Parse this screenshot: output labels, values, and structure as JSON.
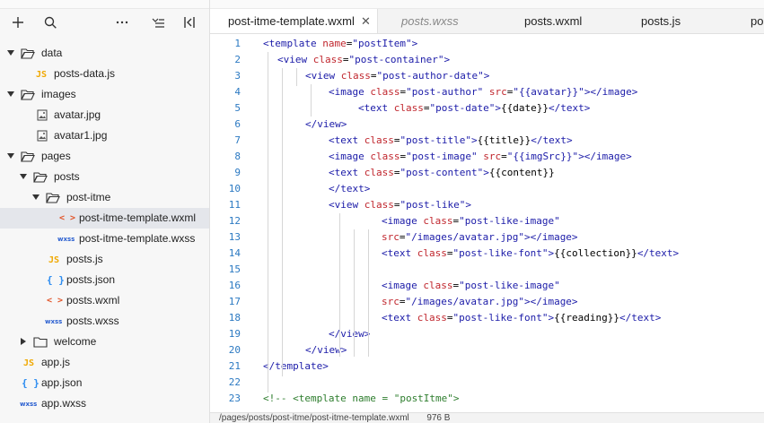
{
  "toolbar": {
    "add": "+",
    "more": "···"
  },
  "tree": [
    {
      "label": "data",
      "type": "folder",
      "depth": 0,
      "expanded": true
    },
    {
      "label": "posts-data.js",
      "type": "js",
      "depth": 1
    },
    {
      "label": "images",
      "type": "folder",
      "depth": 0,
      "expanded": true
    },
    {
      "label": "avatar.jpg",
      "type": "image",
      "depth": 1
    },
    {
      "label": "avatar1.jpg",
      "type": "image",
      "depth": 1
    },
    {
      "label": "pages",
      "type": "folder",
      "depth": 0,
      "expanded": true
    },
    {
      "label": "posts",
      "type": "folder",
      "depth": 1,
      "expanded": true
    },
    {
      "label": "post-itme",
      "type": "folder",
      "depth": 2,
      "expanded": true
    },
    {
      "label": "post-itme-template.wxml",
      "type": "wxml",
      "depth": 3,
      "selected": true
    },
    {
      "label": "post-itme-template.wxss",
      "type": "wxss",
      "depth": 3
    },
    {
      "label": "posts.js",
      "type": "js",
      "depth": 2
    },
    {
      "label": "posts.json",
      "type": "json",
      "depth": 2
    },
    {
      "label": "posts.wxml",
      "type": "wxml",
      "depth": 2
    },
    {
      "label": "posts.wxss",
      "type": "wxss",
      "depth": 2
    },
    {
      "label": "welcome",
      "type": "folder",
      "depth": 1,
      "expanded": false
    },
    {
      "label": "app.js",
      "type": "js",
      "depth": 0
    },
    {
      "label": "app.json",
      "type": "json",
      "depth": 0
    },
    {
      "label": "app.wxss",
      "type": "wxss",
      "depth": 0
    }
  ],
  "icons": {
    "js": "JS",
    "json": "{ }",
    "wxml": "< >",
    "wxss": "wxss"
  },
  "tabs": [
    {
      "label": "post-itme-template.wxml",
      "active": true,
      "closable": true
    },
    {
      "label": "posts.wxss",
      "italic": true
    },
    {
      "label": "posts.wxml"
    },
    {
      "label": "posts.js"
    },
    {
      "label": "po"
    }
  ],
  "close_glyph": "✕",
  "code_lines": [
    {
      "n": "1",
      "indent": 0,
      "tokens": [
        [
          "tag",
          "<template "
        ],
        [
          "attr",
          "name"
        ],
        [
          "plain",
          "="
        ],
        [
          "str",
          "\"postItem\""
        ],
        [
          "tag",
          ">"
        ]
      ]
    },
    {
      "n": "2",
      "indent": 1,
      "tokens": [
        [
          "tag",
          "<view "
        ],
        [
          "attr",
          "class"
        ],
        [
          "plain",
          "="
        ],
        [
          "str",
          "\"post-container\""
        ],
        [
          "tag",
          ">"
        ]
      ]
    },
    {
      "n": "3",
      "indent": 2,
      "tokens": [
        [
          "tag",
          "<view "
        ],
        [
          "attr",
          "class"
        ],
        [
          "plain",
          "="
        ],
        [
          "str",
          "\"post-author-date\""
        ],
        [
          "tag",
          ">"
        ]
      ]
    },
    {
      "n": "4",
      "indent": 3,
      "tokens": [
        [
          "tag",
          "<image "
        ],
        [
          "attr",
          "class"
        ],
        [
          "plain",
          "="
        ],
        [
          "str",
          "\"post-author\" "
        ],
        [
          "attr",
          "src"
        ],
        [
          "plain",
          "="
        ],
        [
          "str",
          "\"{{avatar}}\""
        ],
        [
          "tag",
          "></image>"
        ]
      ]
    },
    {
      "n": "5",
      "indent": 4,
      "tokens": [
        [
          "tag",
          "<text "
        ],
        [
          "attr",
          "class"
        ],
        [
          "plain",
          "="
        ],
        [
          "str",
          "\"post-date\""
        ],
        [
          "tag",
          ">"
        ],
        [
          "plain",
          "{{date}}"
        ],
        [
          "tag",
          "</text>"
        ]
      ]
    },
    {
      "n": "6",
      "indent": 2,
      "tokens": [
        [
          "tag",
          "</view>"
        ]
      ]
    },
    {
      "n": "7",
      "indent": 3,
      "tokens": [
        [
          "tag",
          "<text "
        ],
        [
          "attr",
          "class"
        ],
        [
          "plain",
          "="
        ],
        [
          "str",
          "\"post-title\""
        ],
        [
          "tag",
          ">"
        ],
        [
          "plain",
          "{{title}}"
        ],
        [
          "tag",
          "</text>"
        ]
      ]
    },
    {
      "n": "8",
      "indent": 3,
      "tokens": [
        [
          "tag",
          "<image "
        ],
        [
          "attr",
          "class"
        ],
        [
          "plain",
          "="
        ],
        [
          "str",
          "\"post-image\" "
        ],
        [
          "attr",
          "src"
        ],
        [
          "plain",
          "="
        ],
        [
          "str",
          "\"{{imgSrc}}\""
        ],
        [
          "tag",
          "></image>"
        ]
      ]
    },
    {
      "n": "9",
      "indent": 3,
      "tokens": [
        [
          "tag",
          "<text "
        ],
        [
          "attr",
          "class"
        ],
        [
          "plain",
          "="
        ],
        [
          "str",
          "\"post-content\""
        ],
        [
          "tag",
          ">"
        ],
        [
          "plain",
          "{{content}}"
        ]
      ]
    },
    {
      "n": "10",
      "indent": 3,
      "tokens": [
        [
          "tag",
          "</text>"
        ]
      ]
    },
    {
      "n": "11",
      "indent": 3,
      "tokens": [
        [
          "tag",
          "<view "
        ],
        [
          "attr",
          "class"
        ],
        [
          "plain",
          "="
        ],
        [
          "str",
          "\"post-like\""
        ],
        [
          "tag",
          ">"
        ]
      ]
    },
    {
      "n": "12",
      "indent": 5,
      "tokens": [
        [
          "tag",
          "<image "
        ],
        [
          "attr",
          "class"
        ],
        [
          "plain",
          "="
        ],
        [
          "str",
          "\"post-like-image\""
        ]
      ]
    },
    {
      "n": "13",
      "indent": 5,
      "tokens": [
        [
          "attr",
          "src"
        ],
        [
          "plain",
          "="
        ],
        [
          "str",
          "\"/images/avatar.jpg\""
        ],
        [
          "tag",
          "></image>"
        ]
      ]
    },
    {
      "n": "14",
      "indent": 5,
      "tokens": [
        [
          "tag",
          "<text "
        ],
        [
          "attr",
          "class"
        ],
        [
          "plain",
          "="
        ],
        [
          "str",
          "\"post-like-font\""
        ],
        [
          "tag",
          ">"
        ],
        [
          "plain",
          "{{collection}}"
        ],
        [
          "tag",
          "</text>"
        ]
      ]
    },
    {
      "n": "15",
      "indent": 0,
      "tokens": []
    },
    {
      "n": "16",
      "indent": 5,
      "tokens": [
        [
          "tag",
          "<image "
        ],
        [
          "attr",
          "class"
        ],
        [
          "plain",
          "="
        ],
        [
          "str",
          "\"post-like-image\""
        ]
      ]
    },
    {
      "n": "17",
      "indent": 5,
      "tokens": [
        [
          "attr",
          "src"
        ],
        [
          "plain",
          "="
        ],
        [
          "str",
          "\"/images/avatar.jpg\""
        ],
        [
          "tag",
          "></image>"
        ]
      ]
    },
    {
      "n": "18",
      "indent": 5,
      "tokens": [
        [
          "tag",
          "<text "
        ],
        [
          "attr",
          "class"
        ],
        [
          "plain",
          "="
        ],
        [
          "str",
          "\"post-like-font\""
        ],
        [
          "tag",
          ">"
        ],
        [
          "plain",
          "{{reading}}"
        ],
        [
          "tag",
          "</text>"
        ]
      ]
    },
    {
      "n": "19",
      "indent": 3,
      "tokens": [
        [
          "tag",
          "</view>"
        ]
      ]
    },
    {
      "n": "20",
      "indent": 2,
      "tokens": [
        [
          "tag",
          "</view>"
        ]
      ]
    },
    {
      "n": "21",
      "indent": 0,
      "tokens": [
        [
          "tag",
          "</template>"
        ]
      ]
    },
    {
      "n": "22",
      "indent": 0,
      "tokens": []
    },
    {
      "n": "23",
      "indent": 0,
      "tokens": [
        [
          "comment",
          "<!-- <template name = \"postItme\">"
        ]
      ]
    }
  ],
  "status": {
    "path": "/pages/posts/post-itme/post-itme-template.wxml",
    "size": "976 B"
  }
}
